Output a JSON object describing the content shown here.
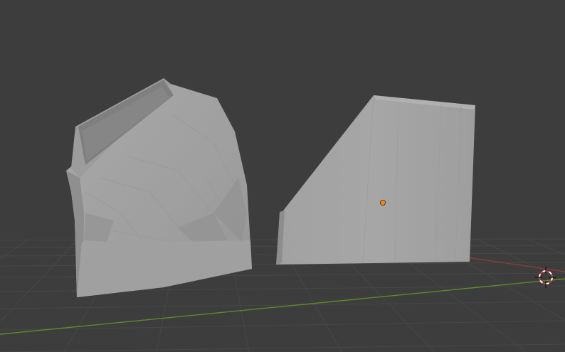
{
  "viewport": {
    "background_color": "#3d3d3d",
    "grid_color": "#474747",
    "x_axis_color": "#8a3a3f",
    "y_axis_color": "#5b8a2c",
    "object_color": "#a3a3a3",
    "origin_color": "#f08a1f"
  },
  "icons": [
    "3d-cursor-icon",
    "object-origin-icon"
  ]
}
